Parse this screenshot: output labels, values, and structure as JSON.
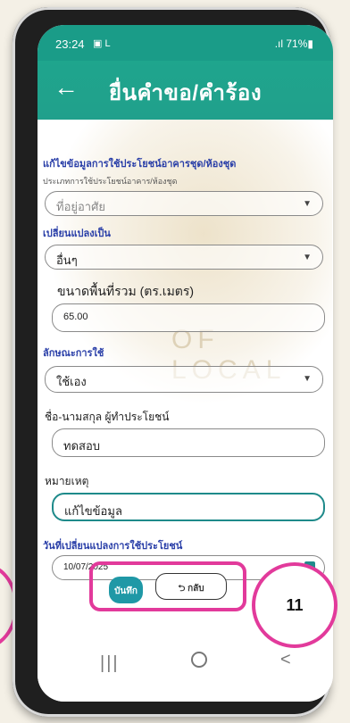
{
  "status": {
    "time": "23:24",
    "notifications": "▣ L",
    "signal_battery": " .ıl 71%▮"
  },
  "header": {
    "back_label": "←",
    "title": "ยื่นคำขอ/คำร้อง"
  },
  "form": {
    "section_change": "แก้ไขข้อมูลการใช้ประโยชน์อาคารชุด/ห้องชุด",
    "label_usage_type": "ประเภทการใช้ประโยชน์อาคาร/ห้องชุด",
    "value_usage_type": "ที่อยู่อาศัย",
    "label_change_to": "เปลี่ยนแปลงเป็น",
    "value_change_to": "อื่นๆ",
    "label_area": "ขนาดพื้นที่รวม (ตร.เมตร)",
    "value_area": "65.00",
    "label_usage_kind": "ลักษณะการใช้",
    "value_usage_kind": "ใช้เอง",
    "label_beneficiary": "ชื่อ-นามสกุล ผู้ทำประโยชน์",
    "value_beneficiary": "ทดสอบ",
    "label_remark": "หมายเหตุ",
    "value_remark": "แก้ไขข้อมูล",
    "label_change_date": "วันที่เปลี่ยนแปลงการใช้ประโยชน์",
    "value_change_date": "10/07/2025"
  },
  "actions": {
    "save_label": "บันทึก",
    "back_label": "⮌ กลับ"
  },
  "annotation": {
    "step_number": "11"
  },
  "watermark_text": "OF   LOCAL",
  "nav": {
    "recent": "|||",
    "home": "",
    "back": "<"
  },
  "colors": {
    "primary": "#1fa58d",
    "highlight": "#e23a9b",
    "section": "#2a3fa8"
  }
}
